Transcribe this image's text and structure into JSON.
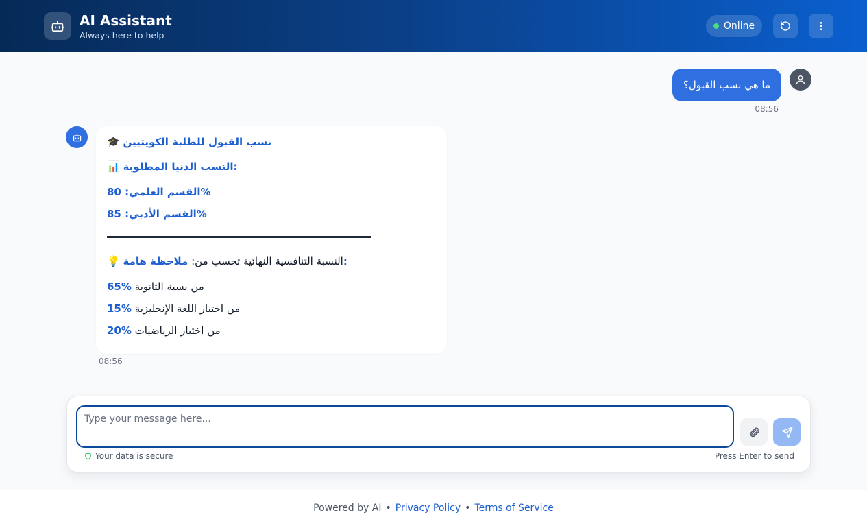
{
  "header": {
    "title": "AI Assistant",
    "subtitle": "Always here to help",
    "status": "Online",
    "colors": {
      "gradient_start": "#062a57",
      "gradient_end": "#0a5fcf",
      "status_dot": "#4ade80"
    },
    "icons": {
      "logo": "robot-icon",
      "refresh": "refresh-icon",
      "menu": "more-vertical-icon"
    }
  },
  "messages": {
    "user": {
      "text": "ما هي نسب القبول؟",
      "time": "08:56",
      "avatar_icon": "user-icon",
      "color": "#2f6fe0"
    },
    "bot": {
      "avatar_icon": "robot-icon",
      "time": "08:56",
      "title_emoji": "🎓",
      "title": "نسب القبول للطلبة الكويتيين",
      "min_emoji": "📊",
      "min_heading": "النسب الدنيا المطلوبة:",
      "science": "القسم العلمي: 80%",
      "literary": "القسم الأدبي: 85%",
      "note_emoji": "💡",
      "note_label": "ملاحظة هامة:",
      "note_text": "النسبة التنافسية النهائية تحسب من:",
      "items": [
        {
          "pct": "65%",
          "text": "من نسبة الثانوية"
        },
        {
          "pct": "15%",
          "text": "من اختبار اللغة الإنجليزية"
        },
        {
          "pct": "20%",
          "text": "من اختبار الرياضيات"
        }
      ]
    }
  },
  "composer": {
    "placeholder": "Type your message here...",
    "value": "",
    "secure_text": "Your data is secure",
    "enter_hint": "Press Enter to send",
    "icons": {
      "attach": "paperclip-icon",
      "send": "send-icon",
      "secure": "shield-icon"
    }
  },
  "footer": {
    "powered": "Powered by AI",
    "sep": "•",
    "privacy": "Privacy Policy",
    "terms": "Terms of Service"
  }
}
